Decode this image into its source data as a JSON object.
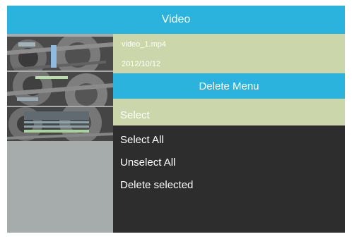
{
  "header": {
    "title": "Video"
  },
  "file": {
    "name": "video_1.mp4",
    "date": "2012/10/12"
  },
  "delete_menu": {
    "title": "Delete Menu",
    "items": [
      {
        "label": "Select",
        "selected": true
      },
      {
        "label": "Select All",
        "selected": false
      },
      {
        "label": "Unselect All",
        "selected": false
      },
      {
        "label": "Delete selected",
        "selected": false
      }
    ]
  },
  "colors": {
    "accent_blue": "#2cb3dd",
    "highlight_green": "#cbd7ab",
    "menu_background": "#2d2d2d",
    "thumbnail_panel": "#a6acab",
    "text": "#ffffff"
  }
}
